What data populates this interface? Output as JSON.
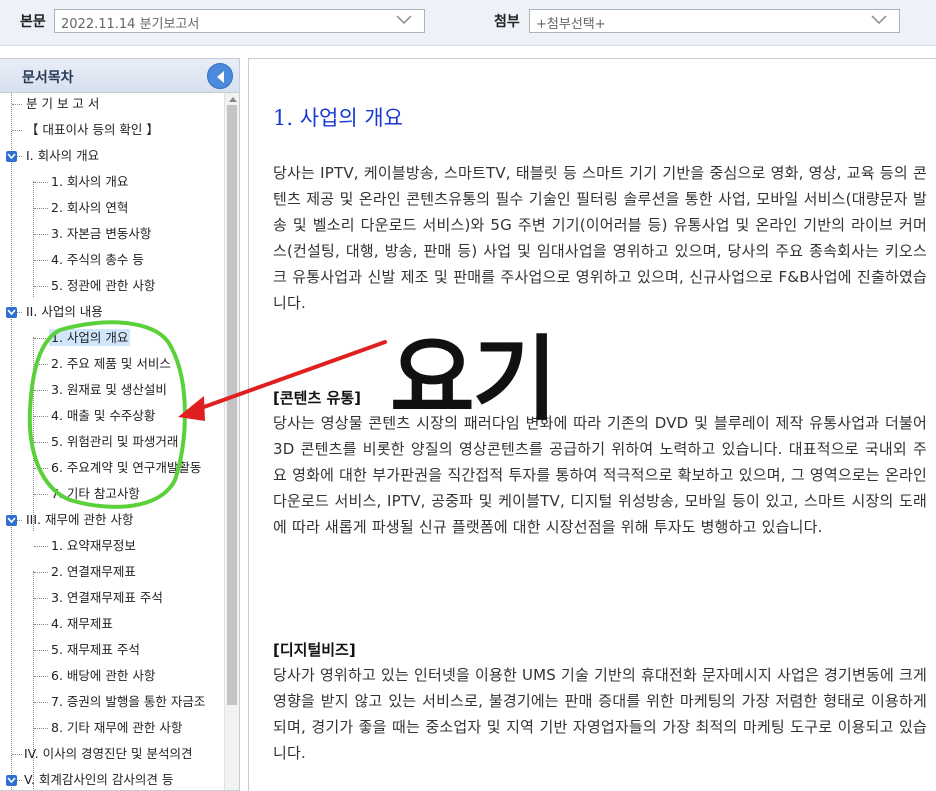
{
  "topbar": {
    "main_label": "본문",
    "main_select": "2022.11.14  분기보고서",
    "attach_label": "첨부",
    "attach_select": "+첨부선택+"
  },
  "sidebar": {
    "title": "문서목차",
    "items": [
      {
        "label": "분 기 보 고 서"
      },
      {
        "label": "【 대표이사 등의 확인 】"
      },
      {
        "label": "I. 회사의 개요"
      },
      {
        "label": "1. 회사의 개요"
      },
      {
        "label": "2. 회사의 연혁"
      },
      {
        "label": "3. 자본금 변동사항"
      },
      {
        "label": "4. 주식의 총수 등"
      },
      {
        "label": "5. 정관에 관한 사항"
      },
      {
        "label": "II. 사업의 내용"
      },
      {
        "label": "1. 사업의 개요"
      },
      {
        "label": "2. 주요 제품 및 서비스"
      },
      {
        "label": "3. 원재료 및 생산설비"
      },
      {
        "label": "4. 매출 및 수주상황"
      },
      {
        "label": "5. 위험관리 및 파생거래"
      },
      {
        "label": "6. 주요계약 및 연구개발활동"
      },
      {
        "label": "7. 기타 참고사항"
      },
      {
        "label": "III. 재무에 관한 사항"
      },
      {
        "label": "1. 요약재무정보"
      },
      {
        "label": "2. 연결재무제표"
      },
      {
        "label": "3. 연결재무제표 주석"
      },
      {
        "label": "4. 재무제표"
      },
      {
        "label": "5. 재무제표 주석"
      },
      {
        "label": "6. 배당에 관한 사항"
      },
      {
        "label": "7. 증권의 발행을 통한 자금조"
      },
      {
        "label": "8. 기타 재무에 관한 사항"
      },
      {
        "label": "IV. 이사의 경영진단 및 분석의견"
      },
      {
        "label": "V. 회계감사인의 감사의견 등"
      }
    ]
  },
  "main": {
    "title": "1. 사업의 개요",
    "para1": "당사는 IPTV, 케이블방송, 스마트TV, 태블릿 등 스마트 기기 기반을 중심으로 영화, 영상, 교육 등의 콘텐츠 제공 및 온라인 콘텐츠유통의 필수 기술인 필터링 솔루션을 통한 사업, 모바일 서비스(대량문자 발송 및 벨소리 다운로드 서비스)와 5G 주변 기기(이어러블 등) 유통사업 및 온라인 기반의 라이브 커머스(컨설팅, 대행, 방송, 판매 등) 사업 및 임대사업을 영위하고 있으며, 당사의 주요 종속회사는 키오스크 유통사업과 신발 제조 및 판매를 주사업으로 영위하고 있으며, 신규사업으로 F&B사업에 진출하였습니다.",
    "sub1": "[콘텐츠 유통]",
    "para2": "당사는 영상물 콘텐츠 시장의 패러다임 변화에 따라 기존의 DVD 및 블루레이 제작 유통사업과 더불어 3D 콘텐츠를 비롯한 양질의 영상콘텐츠를 공급하기 위하여 노력하고 있습니다. 대표적으로 국내외 주요 영화에 대한 부가판권을 직간접적 투자를 통하여 적극적으로 확보하고 있으며, 그 영역으로는 온라인다운로드 서비스, IPTV, 공중파 및 케이블TV, 디지털 위성방송, 모바일 등이 있고, 스마트 시장의 도래에 따라 새롭게 파생될 신규 플랫폼에 대한 시장선점을 위해 투자도 병행하고 있습니다.",
    "sub2": "[디지털비즈]",
    "para3": "당사가 영위하고 있는 인터넷을 이용한 UMS 기술 기반의 휴대전화 문자메시지 사업은 경기변동에 크게 영향을 받지 않고 있는 서비스로, 불경기에는 판매 증대를 위한 마케팅의 가장 저렴한 형태로 이용하게 되며, 경기가 좋을 때는 중소업자 및 지역 기반 자영업자들의 가장 최적의 마케팅 도구로 이용되고 있습니다."
  },
  "overlay": {
    "text": "요기",
    "circle_color": "#5ad13a",
    "arrow_color": "#e02020"
  }
}
